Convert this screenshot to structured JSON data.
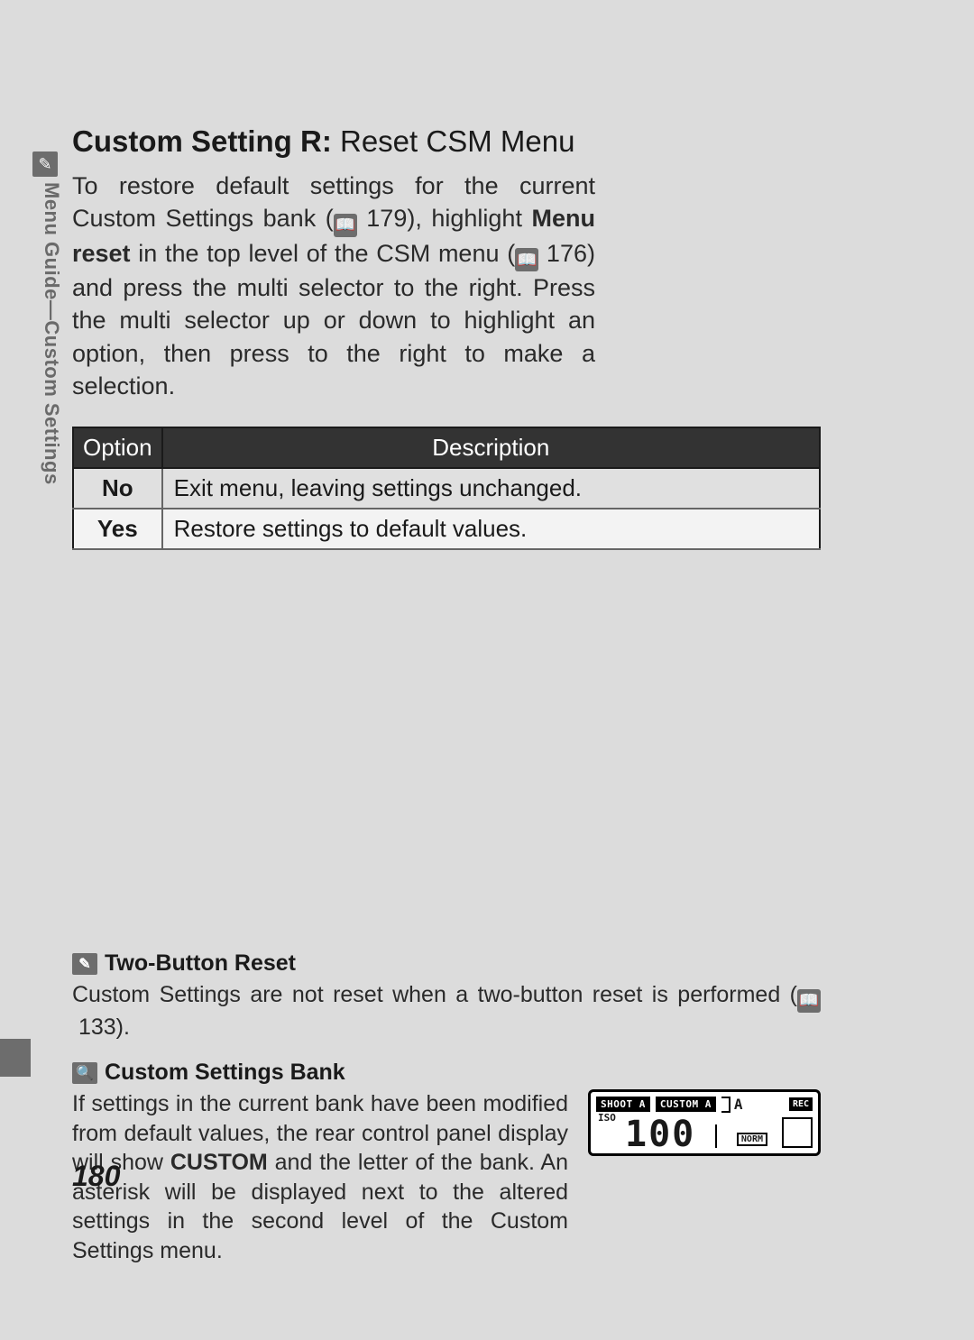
{
  "sidebar": {
    "label": "Menu Guide—Custom Settings",
    "icon_name": "pencil-icon",
    "icon_glyph": "✎"
  },
  "heading": {
    "bold": "Custom Setting R:",
    "light": "Reset CSM Menu"
  },
  "intro": {
    "part1": "To restore default settings for the current Custom Settings bank (",
    "ref1_icon": "📖",
    "ref1_page": "179",
    "part2": "), highlight ",
    "menu_reset": "Menu reset",
    "part3": " in the top level of the CSM menu (",
    "ref2_icon": "📖",
    "ref2_page": "176",
    "part4": ") and press the multi selector to the right.  Press the multi selector up or down to highlight an option, then press to the right to make a selection."
  },
  "table": {
    "headers": {
      "option": "Option",
      "description": "Description"
    },
    "rows": [
      {
        "option": "No",
        "description": "Exit menu, leaving settings unchanged."
      },
      {
        "option": "Yes",
        "description": "Restore settings to default values."
      }
    ]
  },
  "notes": {
    "n1": {
      "icon_glyph": "✎",
      "title": "Two-Button Reset",
      "body_a": "Custom Settings are not reset when a two-button reset is performed (",
      "ref_icon": "📖",
      "ref_page": "133",
      "body_b": ")."
    },
    "n2": {
      "icon_glyph": "🔍",
      "title": "Custom Settings Bank",
      "body_a": "If settings in the current bank have been modified from default values, the rear control panel display will show ",
      "custom": "CUSTOM",
      "body_b": " and the letter of the bank.  An asterisk will be displayed next to the altered settings in the second level of the Custom Settings menu."
    }
  },
  "lcd": {
    "shoot": "SHOOT A",
    "custom": "CUSTOM A",
    "bank_letter": "A",
    "rec": "REC",
    "iso_label": "ISO",
    "iso_value": "100",
    "norm": "NORM"
  },
  "page_number": "180"
}
